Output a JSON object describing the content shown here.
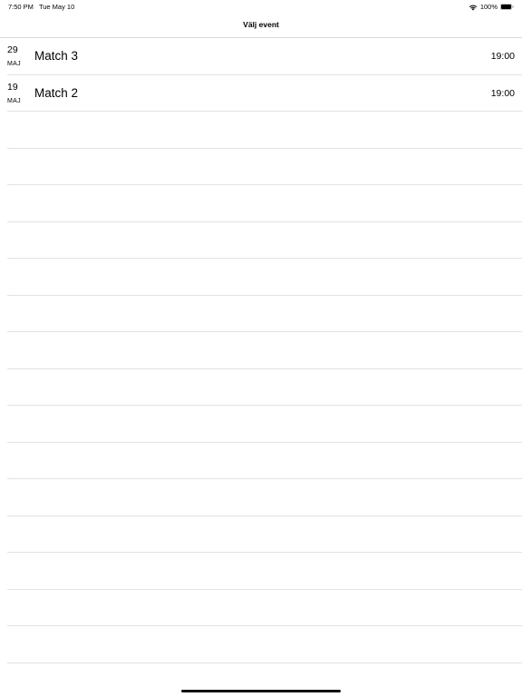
{
  "status_bar": {
    "time": "7:50 PM",
    "date": "Tue May 10",
    "battery": "100%",
    "icons": [
      "wifi-icon",
      "battery-icon"
    ]
  },
  "nav": {
    "title": "Välj event"
  },
  "events": [
    {
      "day": "29",
      "month": "MAJ",
      "title": "Match 3",
      "time": "19:00"
    },
    {
      "day": "19",
      "month": "MAJ",
      "title": "Match 2",
      "time": "19:00"
    }
  ],
  "colors": {
    "background": "#ffffff",
    "separator": "#e2e2e2",
    "text": "#000000"
  }
}
